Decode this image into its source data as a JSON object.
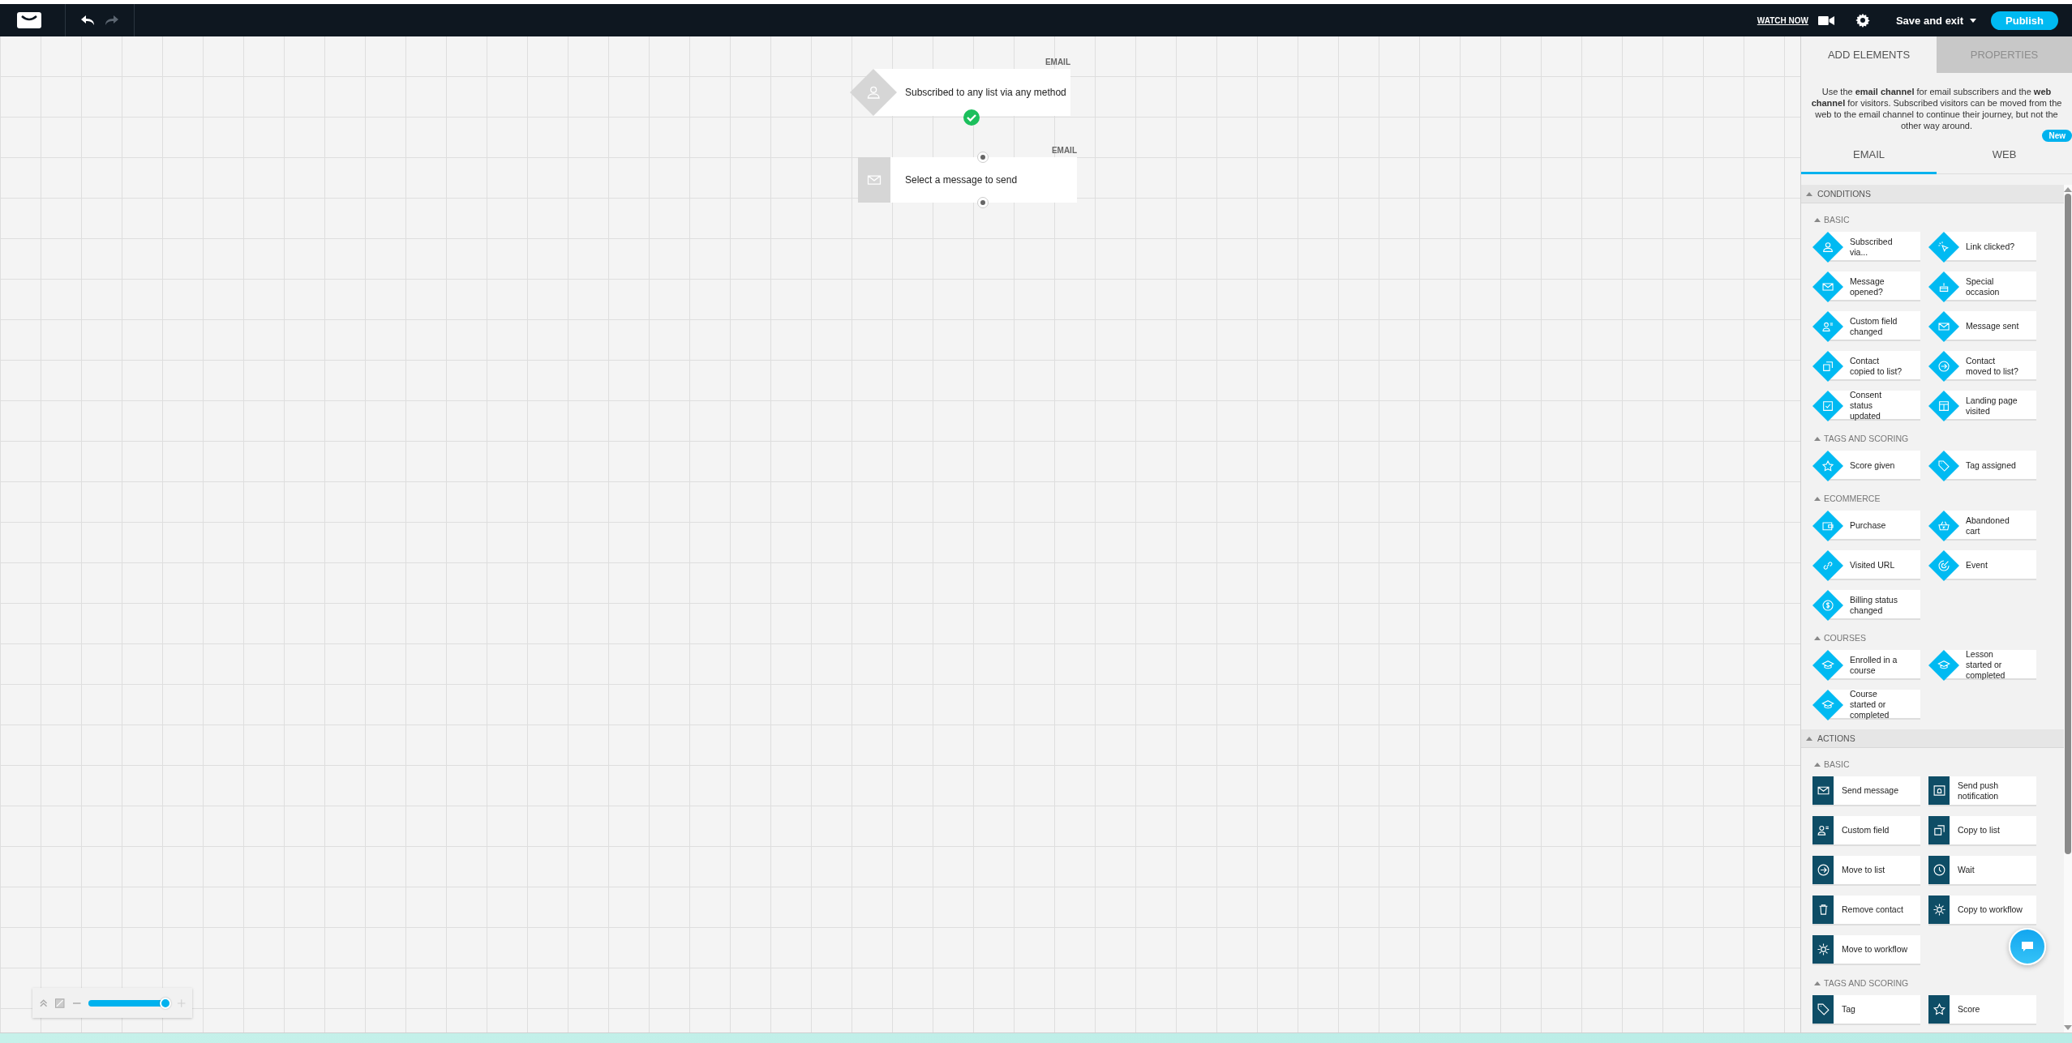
{
  "topbar": {
    "undo": {
      "disabled": false
    },
    "redo": {
      "disabled": true
    },
    "watch_now": "WATCH NOW",
    "save_exit": "Save and exit",
    "publish": "Publish"
  },
  "canvas": {
    "nodes": [
      {
        "kind": "condition",
        "channel": "EMAIL",
        "label": "Subscribed to any list via any method",
        "completed": true,
        "input_port": false
      },
      {
        "kind": "action",
        "channel": "EMAIL",
        "label": "Select a message to send",
        "completed": false,
        "input_port": true
      }
    ],
    "zoom": {
      "level": 0.96,
      "plus_disabled": true
    }
  },
  "panel": {
    "tabs": [
      {
        "label": "ADD ELEMENTS",
        "selected": true
      },
      {
        "label": "PROPERTIES",
        "selected": false
      }
    ],
    "intro": "Use the **email channel** for email subscribers and the **web channel** for visitors. Subscribed visitors can be moved from the web to the email channel to continue their journey, but not the other way around.",
    "channels": [
      {
        "label": "EMAIL",
        "selected": true
      },
      {
        "label": "WEB",
        "selected": false,
        "badge": "New"
      }
    ],
    "sections": [
      {
        "title": "CONDITIONS",
        "kind": "condition",
        "groups": [
          {
            "title": "BASIC",
            "items": [
              {
                "label": "Subscribed via..."
              },
              {
                "label": "Link clicked?"
              },
              {
                "label": "Message opened?"
              },
              {
                "label": "Special occasion"
              },
              {
                "label": "Custom field changed"
              },
              {
                "label": "Message sent"
              },
              {
                "label": "Contact copied to list?"
              },
              {
                "label": "Contact moved to list?"
              },
              {
                "label": "Consent status updated"
              },
              {
                "label": "Landing page visited"
              }
            ]
          },
          {
            "title": "TAGS AND SCORING",
            "items": [
              {
                "label": "Score given"
              },
              {
                "label": "Tag assigned"
              }
            ]
          },
          {
            "title": "ECOMMERCE",
            "items": [
              {
                "label": "Purchase"
              },
              {
                "label": "Abandoned cart"
              },
              {
                "label": "Visited URL"
              },
              {
                "label": "Event"
              },
              {
                "label": "Billing status changed"
              }
            ]
          },
          {
            "title": "COURSES",
            "items": [
              {
                "label": "Enrolled in a course"
              },
              {
                "label": "Lesson started or completed"
              },
              {
                "label": "Course started or completed"
              }
            ]
          }
        ]
      },
      {
        "title": "ACTIONS",
        "kind": "action",
        "groups": [
          {
            "title": "BASIC",
            "items": [
              {
                "label": "Send message"
              },
              {
                "label": "Send push notification"
              },
              {
                "label": "Custom field"
              },
              {
                "label": "Copy to list"
              },
              {
                "label": "Move to list"
              },
              {
                "label": "Wait"
              },
              {
                "label": "Remove contact"
              },
              {
                "label": "Copy to workflow"
              },
              {
                "label": "Move to workflow"
              }
            ]
          },
          {
            "title": "TAGS AND SCORING",
            "items": [
              {
                "label": "Tag"
              },
              {
                "label": "Score"
              }
            ]
          }
        ]
      }
    ]
  }
}
